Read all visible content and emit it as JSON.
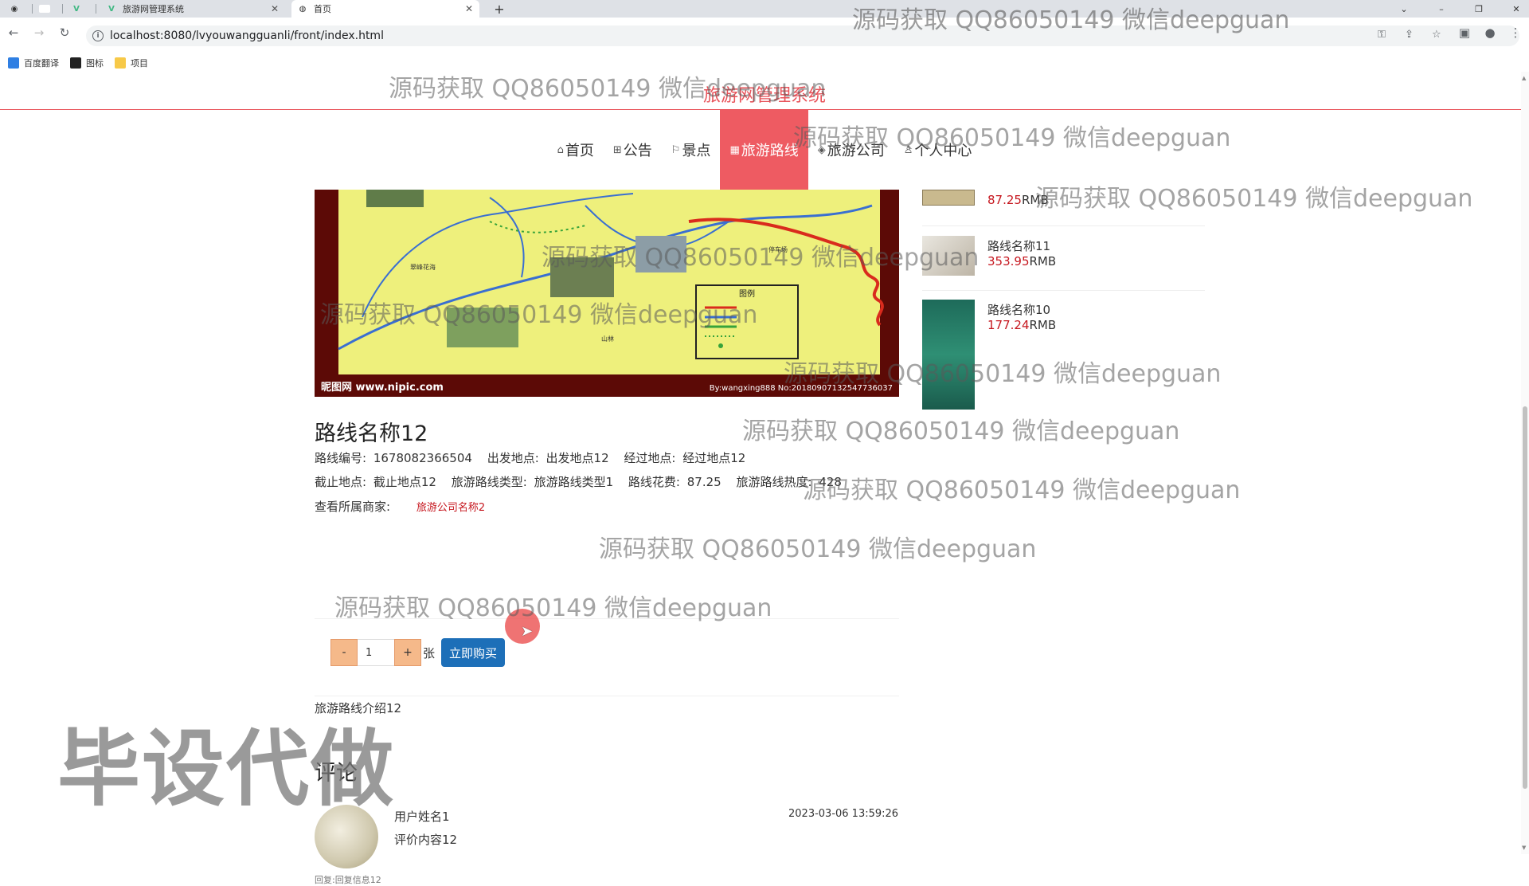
{
  "browser": {
    "tabs": [
      {
        "label": "",
        "icon": "github-icon"
      },
      {
        "label": "",
        "icon": "blank-tab-icon"
      },
      {
        "label": "",
        "icon": "vue-icon"
      },
      {
        "label": "旅游网管理系统",
        "icon": "vue-icon"
      },
      {
        "label": "首页",
        "icon": "globe-icon"
      }
    ],
    "url": "localhost:8080/lvyouwangguanli/front/index.html",
    "bookmarks": [
      "百度翻译",
      "图标",
      "项目"
    ]
  },
  "site": {
    "title": "旅游网管理系统",
    "accent": "#ee5b62"
  },
  "nav": [
    {
      "label": "首页",
      "icon": "⌂",
      "active": false
    },
    {
      "label": "公告",
      "icon": "⊞",
      "active": false
    },
    {
      "label": "景点",
      "icon": "⚐",
      "active": false
    },
    {
      "label": "旅游路线",
      "icon": "▦",
      "active": true
    },
    {
      "label": "旅游公司",
      "icon": "◈",
      "active": false
    },
    {
      "label": "个人中心",
      "icon": "♙",
      "active": false
    }
  ],
  "hero": {
    "brand": "昵图网 www.nipic.com",
    "credit": "By:wangxing888 No:20180907132547736037",
    "legend_title": "图例",
    "place_labels": [
      "翠峰花海",
      "山林",
      "停车场"
    ]
  },
  "route": {
    "title": "路线名称12",
    "fields": [
      {
        "label": "路线编号:",
        "value": "1678082366504"
      },
      {
        "label": "出发地点:",
        "value": "出发地点12"
      },
      {
        "label": "经过地点:",
        "value": "经过地点12"
      },
      {
        "label": "截止地点:",
        "value": "截止地点12"
      },
      {
        "label": "旅游路线类型:",
        "value": "旅游路线类型1"
      },
      {
        "label": "路线花费:",
        "value": "87.25"
      },
      {
        "label": "旅游路线热度:",
        "value": "428"
      }
    ],
    "merchant_label": "查看所属商家:",
    "merchant_link": "旅游公司名称2",
    "intro": "旅游路线介绍12"
  },
  "purchase": {
    "minus": "-",
    "quantity": "1",
    "plus": "+",
    "unit": "张",
    "buy_label": "立即购买"
  },
  "comments": {
    "heading": "评论",
    "items": [
      {
        "user": "用户姓名1",
        "content": "评价内容12",
        "time": "2023-03-06 13:59:26",
        "reply": "回复:回复信息12"
      }
    ]
  },
  "sidebar": {
    "items": [
      {
        "name": "",
        "price": "87.25",
        "currency": "RMB"
      },
      {
        "name": "路线名称11",
        "price": "353.95",
        "currency": "RMB"
      },
      {
        "name": "路线名称10",
        "price": "177.24",
        "currency": "RMB"
      }
    ]
  },
  "watermarks": {
    "text": "源码获取 QQ86050149 微信deepguan",
    "big": "毕设代做"
  }
}
